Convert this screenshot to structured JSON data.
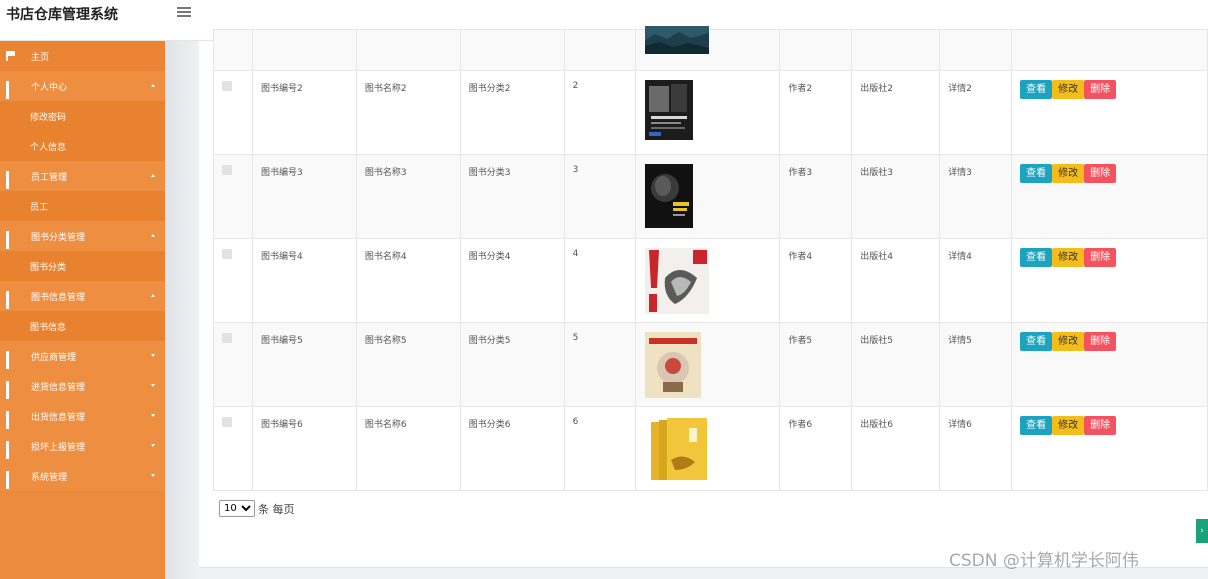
{
  "app": {
    "title": "书店仓库管理系统"
  },
  "sidebar": {
    "items": [
      {
        "label": "主页",
        "type": "home",
        "icon": "flag-icon"
      },
      {
        "label": "个人中心",
        "type": "parent",
        "expanded": true
      },
      {
        "label": "修改密码",
        "type": "child"
      },
      {
        "label": "个人信息",
        "type": "child"
      },
      {
        "label": "员工管理",
        "type": "parent",
        "expanded": true
      },
      {
        "label": "员工",
        "type": "child"
      },
      {
        "label": "图书分类管理",
        "type": "parent",
        "expanded": true
      },
      {
        "label": "图书分类",
        "type": "child"
      },
      {
        "label": "图书信息管理",
        "type": "parent",
        "expanded": true
      },
      {
        "label": "图书信息",
        "type": "child"
      },
      {
        "label": "供应商管理",
        "type": "parent",
        "expanded": false
      },
      {
        "label": "进货信息管理",
        "type": "parent",
        "expanded": false
      },
      {
        "label": "出货信息管理",
        "type": "parent",
        "expanded": false
      },
      {
        "label": "损坏上报管理",
        "type": "parent",
        "expanded": false
      },
      {
        "label": "系统管理",
        "type": "parent",
        "expanded": false
      }
    ]
  },
  "table": {
    "rows": [
      {
        "code": "图书编号2",
        "name": "图书名称2",
        "category": "图书分类2",
        "qty": "2",
        "author": "作者2",
        "publisher": "出版社2",
        "detail": "详情2"
      },
      {
        "code": "图书编号3",
        "name": "图书名称3",
        "category": "图书分类3",
        "qty": "3",
        "author": "作者3",
        "publisher": "出版社3",
        "detail": "详情3"
      },
      {
        "code": "图书编号4",
        "name": "图书名称4",
        "category": "图书分类4",
        "qty": "4",
        "author": "作者4",
        "publisher": "出版社4",
        "detail": "详情4"
      },
      {
        "code": "图书编号5",
        "name": "图书名称5",
        "category": "图书分类5",
        "qty": "5",
        "author": "作者5",
        "publisher": "出版社5",
        "detail": "详情5"
      },
      {
        "code": "图书编号6",
        "name": "图书名称6",
        "category": "图书分类6",
        "qty": "6",
        "author": "作者6",
        "publisher": "出版社6",
        "detail": "详情6"
      }
    ],
    "actions": {
      "view": "查看",
      "edit": "修改",
      "delete": "删除"
    }
  },
  "pager": {
    "page_size": "10",
    "suffix": "条 每页"
  },
  "watermark": "CSDN @计算机学长阿伟",
  "colors": {
    "sidebar": "#ed8b3c",
    "view": "#1ca3bf",
    "edit": "#f5bd1c",
    "delete": "#f3525f"
  }
}
